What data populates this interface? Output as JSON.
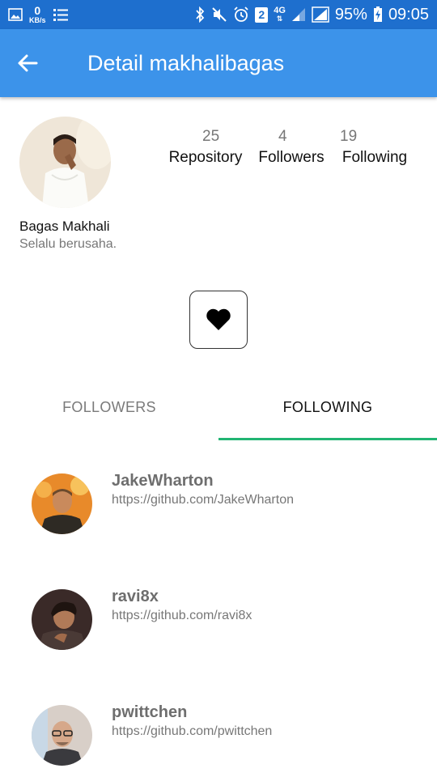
{
  "status_bar": {
    "net_speed_value": "0",
    "net_speed_unit": "KB/s",
    "network_type": "4G",
    "sim_slot": "2",
    "battery": "95%",
    "time": "09:05"
  },
  "app_bar": {
    "title": "Detail makhalibagas"
  },
  "profile": {
    "name": "Bagas Makhali",
    "bio": "Selalu berusaha."
  },
  "stats": [
    {
      "count": "25",
      "label": "Repository"
    },
    {
      "count": "4",
      "label": "Followers"
    },
    {
      "count": "19",
      "label": "Following"
    }
  ],
  "tabs": {
    "followers": "FOLLOWERS",
    "following": "FOLLOWING",
    "selected": "following"
  },
  "users": [
    {
      "login": "JakeWharton",
      "url": "https://github.com/JakeWharton"
    },
    {
      "login": "ravi8x",
      "url": "https://github.com/ravi8x"
    },
    {
      "login": "pwittchen",
      "url": "https://github.com/pwittchen"
    }
  ],
  "colors": {
    "status_bar": "#1e6fce",
    "app_bar": "#3c93ea",
    "tab_indicator": "#22b573"
  }
}
